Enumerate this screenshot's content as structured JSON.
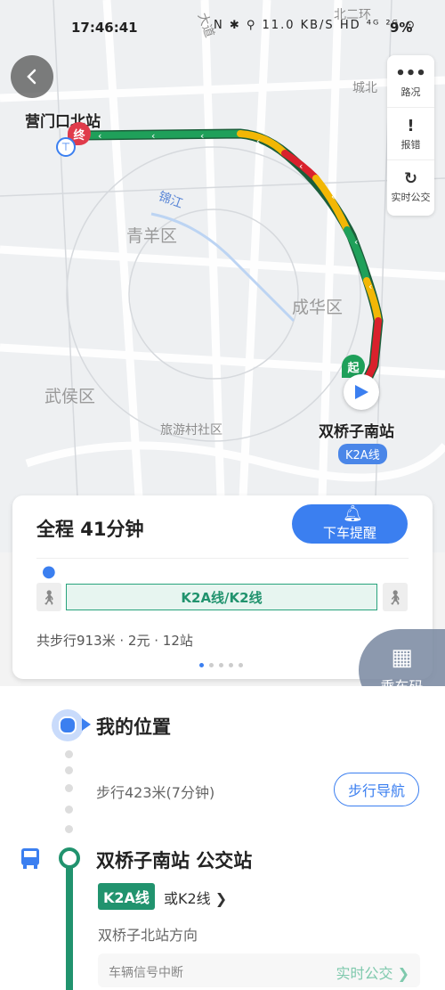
{
  "status_bar": {
    "time": "17:46:41",
    "indicators": "N ✱ ⚲ 11.0 KB/S HD ⁴ᴳ ²ᴳ ⊙",
    "battery": "9%"
  },
  "map": {
    "districts": [
      "青羊区",
      "成华区",
      "武侯区"
    ],
    "community": "旅游村社区",
    "river": "锦江",
    "road_labels": [
      "大道",
      "北二环",
      "城北"
    ],
    "end_station": "营门口北站",
    "end_marker": "终",
    "start_station": "双桥子南站",
    "start_marker": "起",
    "start_line_tag": "K2A线"
  },
  "side_tools": [
    {
      "label": "路况",
      "icon": "traffic-icon"
    },
    {
      "label": "报错",
      "icon": "report-icon"
    },
    {
      "label": "实时公交",
      "icon": "refresh-icon"
    }
  ],
  "card": {
    "total": "全程  41分钟",
    "alert_button": "下车提醒",
    "line_bar": "K2A线/K2线",
    "summary": "共步行913米 · 2元 · 12站"
  },
  "ride_code": "乘车码",
  "steps": {
    "my_location": "我的位置",
    "walk_text": "步行423米(7分钟)",
    "walk_nav": "步行导航",
    "bus_stop": "双桥子南站 公交站",
    "line_chip": "K2A线",
    "or_line": "或K2线 ❯",
    "direction": "双桥子北站方向",
    "signal_label": "车辆信号中断",
    "realtime": "实时公交 ❯"
  },
  "colors": {
    "accent": "#3b7ff0",
    "route_green": "#1fa05a",
    "route_yellow": "#f2b705",
    "route_red": "#d9212c",
    "bus_line": "#21936e"
  }
}
